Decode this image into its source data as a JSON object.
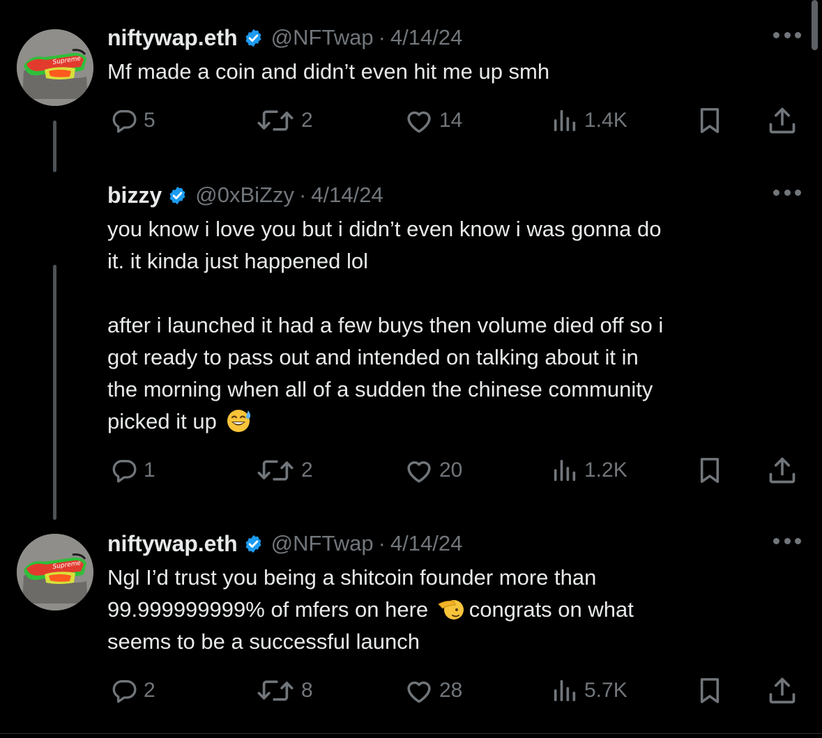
{
  "tweets": [
    {
      "name": "niftywap.eth",
      "handle": "@NFTwap",
      "separator": "·",
      "date": "4/14/24",
      "lines": [
        "Mf made a coin and didn’t even hit me up smh"
      ],
      "stats": {
        "replies": "5",
        "reposts": "2",
        "likes": "14",
        "views": "1.4K"
      }
    },
    {
      "name": "bizzy",
      "handle": "@0xBiZzy",
      "separator": "·",
      "date": "4/14/24",
      "lines": [
        "you know i love you but i didn’t even know i was gonna do",
        "it. it kinda just happened lol",
        "after i launched it had a few buys then volume died off so i",
        "got ready to pass out and intended on talking about it in",
        "the morning when all of a sudden the chinese community",
        "picked it up"
      ],
      "emoji": "sweat-smile-emoji",
      "stats": {
        "replies": "1",
        "reposts": "2",
        "likes": "20",
        "views": "1.2K"
      }
    },
    {
      "name": "niftywap.eth",
      "handle": "@NFTwap",
      "separator": "·",
      "date": "4/14/24",
      "lines": [
        "Ngl I’d trust you being a shitcoin founder more than",
        "99.999999999% of mfers on here",
        "congrats on what",
        "seems to be a successful launch"
      ],
      "emoji": "saluting-face-emoji",
      "stats": {
        "replies": "2",
        "reposts": "8",
        "likes": "28",
        "views": "5.7K"
      }
    }
  ],
  "icons": {
    "verified": "verified-badge-icon",
    "reply": "reply-icon",
    "repost": "repost-icon",
    "like": "heart-icon",
    "views": "views-icon",
    "bookmark": "bookmark-icon",
    "share": "share-icon",
    "more": "more-icon"
  },
  "avatar_text": "Supreme",
  "colors": {
    "background": "#000000",
    "text": "#e7e9ea",
    "secondary": "#71767b",
    "verified": "#1d9bf0"
  }
}
